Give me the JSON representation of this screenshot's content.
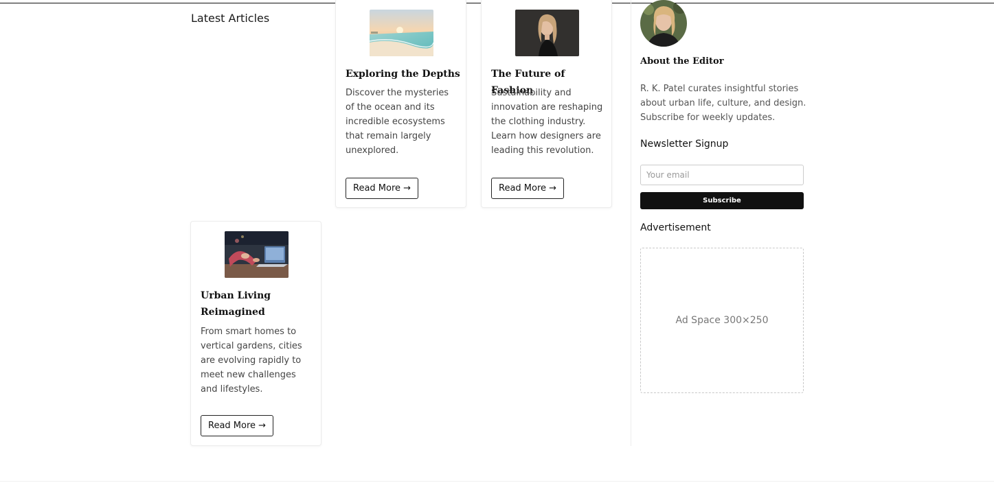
{
  "main": {
    "section_title": "Latest Articles",
    "articles": [
      {
        "title": "Exploring the Depths",
        "excerpt": "Discover the mysteries of the ocean and its incredible ecosystems that remain largely unexplored.",
        "button": "Read More →"
      },
      {
        "title": "The Future of Fashion",
        "excerpt": "Sustainability and innovation are reshaping the clothing industry. Learn how designers are leading this revolution.",
        "button": "Read More →"
      },
      {
        "title": "Urban Living Reimagined",
        "excerpt": "From smart homes to vertical gardens, cities are evolving rapidly to meet new challenges and lifestyles.",
        "button": "Read More →"
      }
    ]
  },
  "sidebar": {
    "about_title": "About the Editor",
    "about_text": "R. K. Patel curates insightful stories about urban life, culture, and design. Subscribe for weekly updates.",
    "newsletter_title": "Newsletter Signup",
    "email_placeholder": "Your email",
    "subscribe_label": "Subscribe",
    "ad_title": "Advertisement",
    "ad_text": "Ad Space 300×250"
  },
  "colors": {
    "accent": "#111111",
    "muted_text": "#555555",
    "border": "#ececec"
  }
}
